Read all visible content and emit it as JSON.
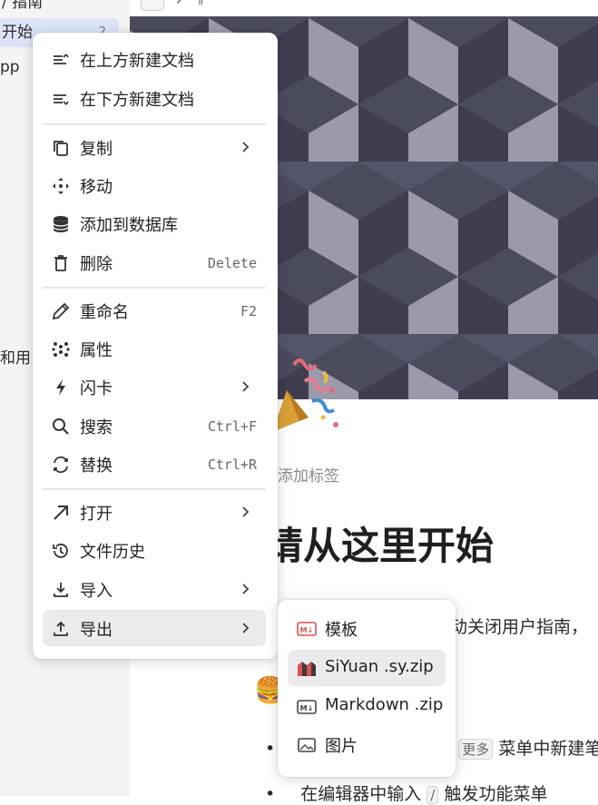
{
  "sidebar": {
    "items": [
      {
        "label": "/ 指南"
      },
      {
        "label": "开始",
        "count": "2"
      },
      {
        "label": "pp"
      },
      {
        "label": "和用"
      }
    ]
  },
  "document": {
    "title": "请从这里开始",
    "add_tag": "添加标签",
    "paragraph": "动关闭用户指南，",
    "bullet1_kbd": "更多",
    "bullet1_text": "菜单中新建笔",
    "bullet2_text": "在编辑器中输入",
    "bullet2_kbd": "/",
    "bullet2_text2": "触发功能菜单"
  },
  "menu": {
    "items": [
      {
        "label": "在上方新建文档",
        "icon": "insert-above-icon"
      },
      {
        "label": "在下方新建文档",
        "icon": "insert-below-icon"
      },
      {
        "label": "复制",
        "icon": "copy-icon",
        "submenu": true
      },
      {
        "label": "移动",
        "icon": "move-icon"
      },
      {
        "label": "添加到数据库",
        "icon": "database-icon"
      },
      {
        "label": "删除",
        "icon": "trash-icon",
        "shortcut": "Delete"
      },
      {
        "label": "重命名",
        "icon": "pencil-icon",
        "shortcut": "F2"
      },
      {
        "label": "属性",
        "icon": "attributes-icon"
      },
      {
        "label": "闪卡",
        "icon": "flashcard-icon",
        "submenu": true
      },
      {
        "label": "搜索",
        "icon": "search-icon",
        "shortcut": "Ctrl+F"
      },
      {
        "label": "替换",
        "icon": "replace-icon",
        "shortcut": "Ctrl+R"
      },
      {
        "label": "打开",
        "icon": "open-icon",
        "submenu": true
      },
      {
        "label": "文件历史",
        "icon": "history-icon"
      },
      {
        "label": "导入",
        "icon": "import-icon",
        "submenu": true
      },
      {
        "label": "导出",
        "icon": "export-icon",
        "submenu": true
      }
    ]
  },
  "export_submenu": {
    "items": [
      {
        "label": "模板",
        "icon": "markdown-template-icon"
      },
      {
        "label": "SiYuan .sy.zip",
        "icon": "siyuan-icon"
      },
      {
        "label": "Markdown .zip",
        "icon": "markdown-icon"
      },
      {
        "label": "图片",
        "icon": "image-icon"
      }
    ]
  },
  "colors": {
    "menu_hover": "#ebebed",
    "sidebar_active": "#dde4f7",
    "cover_dark": "#3f3f52",
    "cover_mid": "#5a5a6d",
    "cover_light": "#9b9aab"
  }
}
